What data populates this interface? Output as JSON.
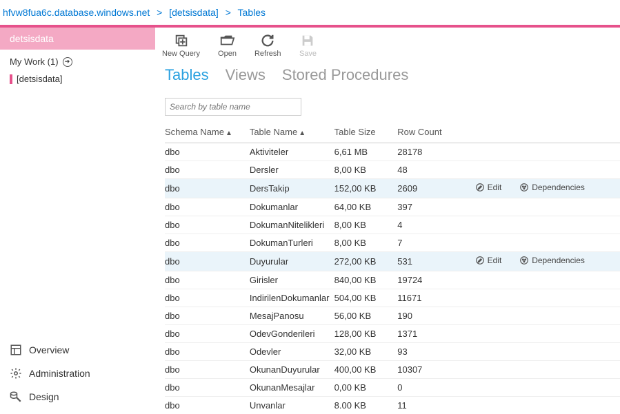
{
  "breadcrumb": {
    "server": "hfvw8fua6c.database.windows.net",
    "db": "[detsisdata]",
    "section": "Tables"
  },
  "sidebar": {
    "dbName": "detsisdata",
    "myWork": "My Work (1)",
    "treeItem": "[detsisdata]",
    "nav": {
      "overview": "Overview",
      "administration": "Administration",
      "design": "Design"
    }
  },
  "toolbar": {
    "newQuery": "New Query",
    "open": "Open",
    "refresh": "Refresh",
    "save": "Save"
  },
  "tabs": {
    "tables": "Tables",
    "views": "Views",
    "sprocs": "Stored Procedures"
  },
  "search": {
    "placeholder": "Search by table name"
  },
  "tableHeaders": {
    "schema": "Schema Name",
    "tableName": "Table Name",
    "tableSize": "Table Size",
    "rowCount": "Row Count"
  },
  "actions": {
    "edit": "Edit",
    "dependencies": "Dependencies"
  },
  "rows": [
    {
      "schema": "dbo",
      "name": "Aktiviteler",
      "size": "6,61 MB",
      "rows": "28178",
      "hover": false
    },
    {
      "schema": "dbo",
      "name": "Dersler",
      "size": "8,00 KB",
      "rows": "48",
      "hover": false
    },
    {
      "schema": "dbo",
      "name": "DersTakip",
      "size": "152,00 KB",
      "rows": "2609",
      "hover": true
    },
    {
      "schema": "dbo",
      "name": "Dokumanlar",
      "size": "64,00 KB",
      "rows": "397",
      "hover": false
    },
    {
      "schema": "dbo",
      "name": "DokumanNitelikleri",
      "size": "8,00 KB",
      "rows": "4",
      "hover": false
    },
    {
      "schema": "dbo",
      "name": "DokumanTurleri",
      "size": "8,00 KB",
      "rows": "7",
      "hover": false
    },
    {
      "schema": "dbo",
      "name": "Duyurular",
      "size": "272,00 KB",
      "rows": "531",
      "hover": true
    },
    {
      "schema": "dbo",
      "name": "Girisler",
      "size": "840,00 KB",
      "rows": "19724",
      "hover": false
    },
    {
      "schema": "dbo",
      "name": "IndirilenDokumanlar",
      "size": "504,00 KB",
      "rows": "11671",
      "hover": false
    },
    {
      "schema": "dbo",
      "name": "MesajPanosu",
      "size": "56,00 KB",
      "rows": "190",
      "hover": false
    },
    {
      "schema": "dbo",
      "name": "OdevGonderileri",
      "size": "128,00 KB",
      "rows": "1371",
      "hover": false
    },
    {
      "schema": "dbo",
      "name": "Odevler",
      "size": "32,00 KB",
      "rows": "93",
      "hover": false
    },
    {
      "schema": "dbo",
      "name": "OkunanDuyurular",
      "size": "400,00 KB",
      "rows": "10307",
      "hover": false
    },
    {
      "schema": "dbo",
      "name": "OkunanMesajlar",
      "size": "0,00 KB",
      "rows": "0",
      "hover": false
    },
    {
      "schema": "dbo",
      "name": "Unvanlar",
      "size": "8.00 KB",
      "rows": "11",
      "hover": false
    }
  ]
}
